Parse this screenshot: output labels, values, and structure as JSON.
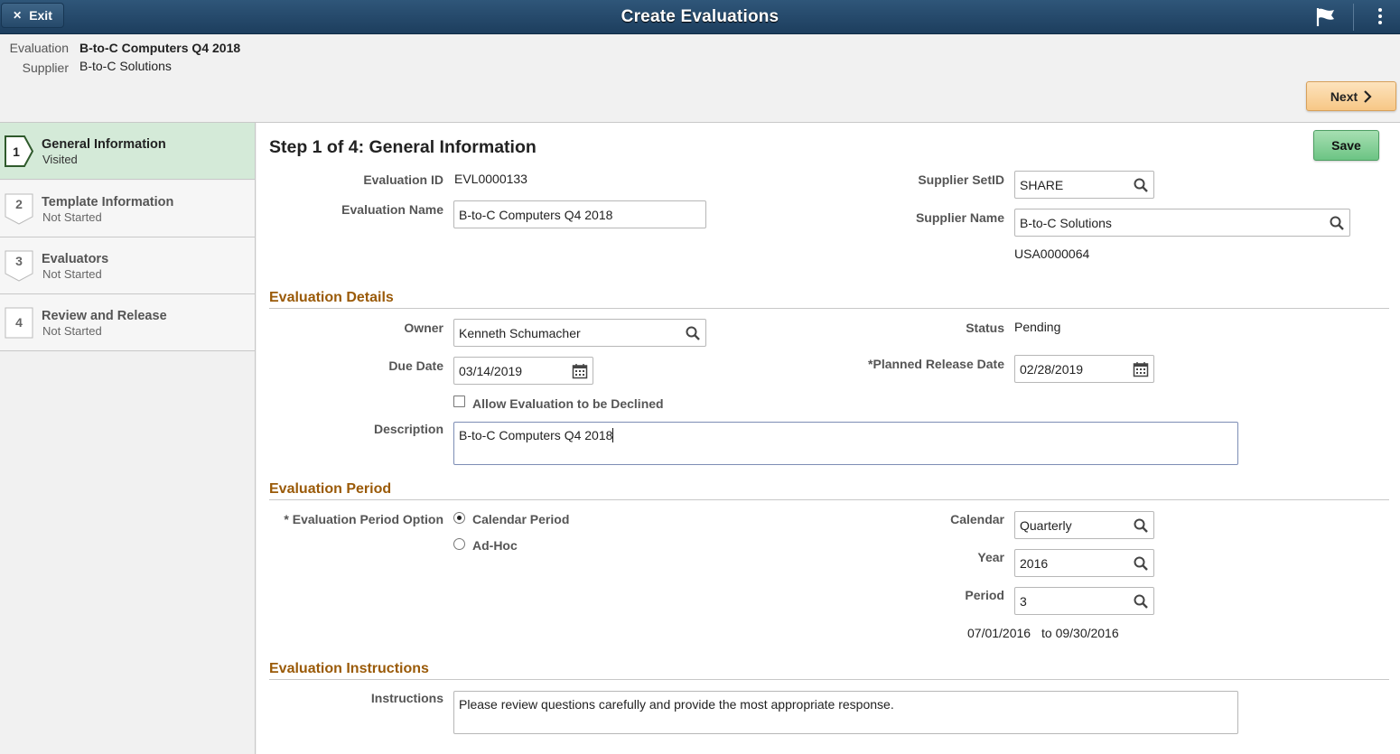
{
  "banner": {
    "title": "Create Evaluations",
    "exit_label": "Exit"
  },
  "header": {
    "evaluation_label": "Evaluation",
    "evaluation_value": "B-to-C Computers  Q4 2018",
    "supplier_label": "Supplier",
    "supplier_value": "B-to-C Solutions",
    "next_label": "Next"
  },
  "steps": [
    {
      "number": "1",
      "name": "General Information",
      "status": "Visited"
    },
    {
      "number": "2",
      "name": "Template Information",
      "status": "Not Started"
    },
    {
      "number": "3",
      "name": "Evaluators",
      "status": "Not Started"
    },
    {
      "number": "4",
      "name": "Review and Release",
      "status": "Not Started"
    }
  ],
  "main": {
    "title": "Step 1 of 4: General Information",
    "save_label": "Save",
    "evaluation_id_label": "Evaluation ID",
    "evaluation_id": "EVL0000133",
    "evaluation_name_label": "Evaluation Name",
    "evaluation_name": "B-to-C Computers  Q4 2018",
    "supplier_setid_label": "Supplier SetID",
    "supplier_setid": "SHARE",
    "supplier_name_label": "Supplier Name",
    "supplier_name": "B-to-C Solutions",
    "supplier_id": "USA0000064"
  },
  "details": {
    "section_title": "Evaluation Details",
    "owner_label": "Owner",
    "owner": "Kenneth Schumacher",
    "status_label": "Status",
    "status": "Pending",
    "due_date_label": "Due Date",
    "due_date": "03/14/2019",
    "planned_release_label": "*Planned Release Date",
    "planned_release": "02/28/2019",
    "allow_decline_label": "Allow Evaluation to be Declined",
    "allow_decline_checked": false,
    "description_label": "Description",
    "description": "B-to-C Computers  Q4 2018"
  },
  "period": {
    "section_title": "Evaluation Period",
    "option_label": "* Evaluation Period Option",
    "options": [
      "Calendar Period",
      "Ad-Hoc"
    ],
    "selected_option": "Calendar Period",
    "calendar_label": "Calendar",
    "calendar": "Quarterly",
    "year_label": "Year",
    "year": "2016",
    "period_label": "Period",
    "period": "3",
    "range_from": "07/01/2016",
    "range_to": "to 09/30/2016"
  },
  "instructions": {
    "section_title": "Evaluation Instructions",
    "label": "Instructions",
    "text": "Please review questions carefully and provide the most appropriate response."
  },
  "colors": {
    "banner": "#1d3e5e",
    "section_title": "#9a5a08",
    "active_step": "#d4ead8",
    "save": "#6cc484",
    "next": "#f7c786"
  }
}
